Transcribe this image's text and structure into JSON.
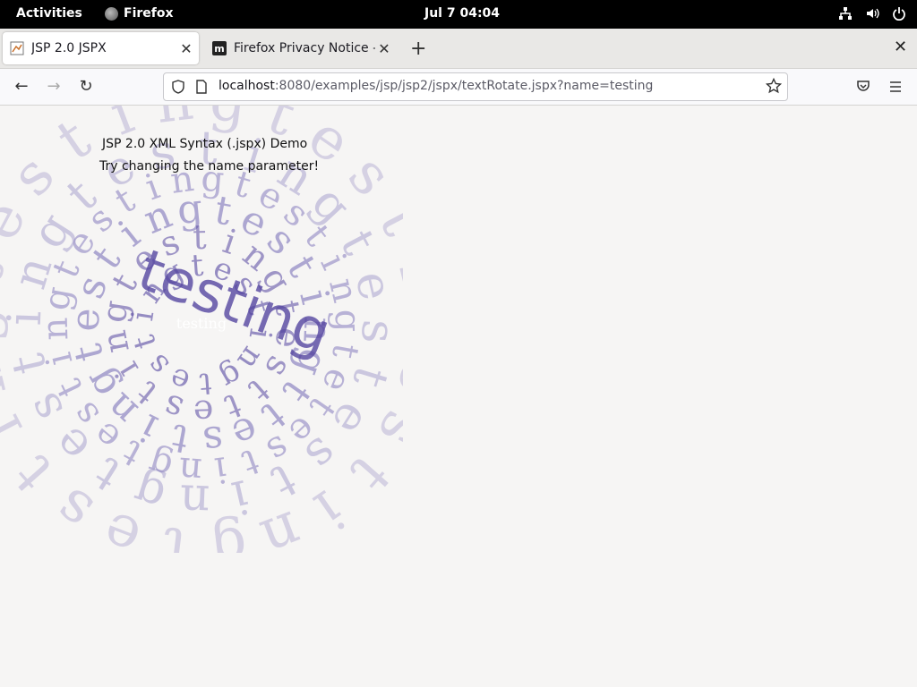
{
  "system": {
    "activities": "Activities",
    "app_name": "Firefox",
    "clock": "Jul 7  04:04",
    "icons": [
      "network-icon",
      "volume-icon",
      "power-icon"
    ]
  },
  "tabs": [
    {
      "label": "JSP 2.0 JSPX",
      "active": true,
      "favicon": "tomcat-icon"
    },
    {
      "label": "Firefox Privacy Notice — M",
      "active": false,
      "favicon": "mozilla-icon"
    }
  ],
  "nav": {
    "url_host": "localhost",
    "url_rest": ":8080/examples/jsp/jsp2/jspx/textRotate.jspx?name=testing"
  },
  "page": {
    "title": "JSP 2.0 XML Syntax (.jspx) Demo",
    "subtitle": "Try changing the name parameter!",
    "name": "testing"
  },
  "colors": {
    "spiral_light": "#b9b3d6",
    "spiral_mid": "#8f86c2",
    "spiral_dark": "#5546a0"
  }
}
